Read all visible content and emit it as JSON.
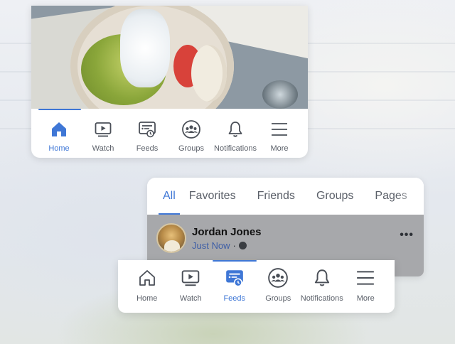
{
  "top_nav": {
    "items": [
      {
        "label": "Home",
        "icon": "home-icon"
      },
      {
        "label": "Watch",
        "icon": "watch-icon"
      },
      {
        "label": "Feeds",
        "icon": "feeds-icon"
      },
      {
        "label": "Groups",
        "icon": "groups-icon"
      },
      {
        "label": "Notifications",
        "icon": "bell-icon"
      },
      {
        "label": "More",
        "icon": "menu-icon"
      }
    ],
    "active": "Home"
  },
  "feed_tabs": {
    "items": [
      "All",
      "Favorites",
      "Friends",
      "Groups",
      "Pages"
    ],
    "active": "All"
  },
  "post": {
    "author": "Jordan Jones",
    "time": "Just Now",
    "separator": "·",
    "privacy_icon": "globe-icon",
    "more_label": "•••"
  },
  "bottom_nav": {
    "items": [
      {
        "label": "Home",
        "icon": "home-outline-icon"
      },
      {
        "label": "Watch",
        "icon": "watch-icon"
      },
      {
        "label": "Feeds",
        "icon": "feeds-icon"
      },
      {
        "label": "Groups",
        "icon": "groups-icon"
      },
      {
        "label": "Notifications",
        "icon": "bell-icon"
      },
      {
        "label": "More",
        "icon": "menu-icon"
      }
    ],
    "active": "Feeds"
  },
  "colors": {
    "accent": "#3f77d6",
    "label": "#5b6069",
    "icon": "#4a4f57"
  }
}
